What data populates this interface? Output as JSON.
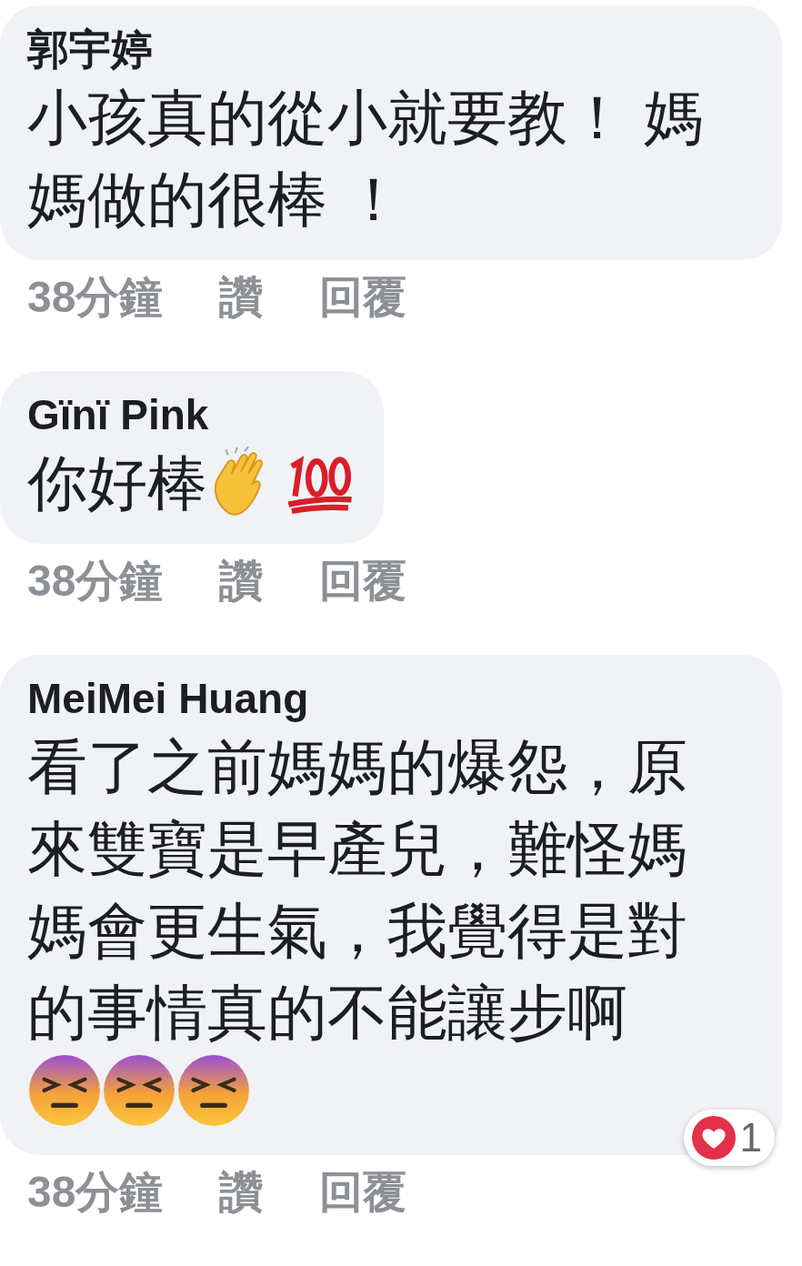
{
  "comments": [
    {
      "author": "郭宇婷",
      "text": "小孩真的從小就要教！ 媽媽做的很棒 ！",
      "time": "38分鐘",
      "like": "讚",
      "reply": "回覆"
    },
    {
      "author": "Gïnï Pink",
      "text": "你好棒",
      "emojis": [
        {
          "kind": "clap"
        },
        {
          "kind": "hundred"
        }
      ],
      "time": "38分鐘",
      "like": "讚",
      "reply": "回覆"
    },
    {
      "author": "MeiMei Huang",
      "text": "看了之前媽媽的爆怨，原來雙寶是早產兒，難怪媽媽會更生氣，我覺得是對的事情真的不能讓步啊",
      "emojis": [
        {
          "kind": "persevere"
        },
        {
          "kind": "persevere"
        },
        {
          "kind": "persevere"
        }
      ],
      "time": "38分鐘",
      "like": "讚",
      "reply": "回覆",
      "reaction": {
        "count": "1"
      }
    }
  ]
}
